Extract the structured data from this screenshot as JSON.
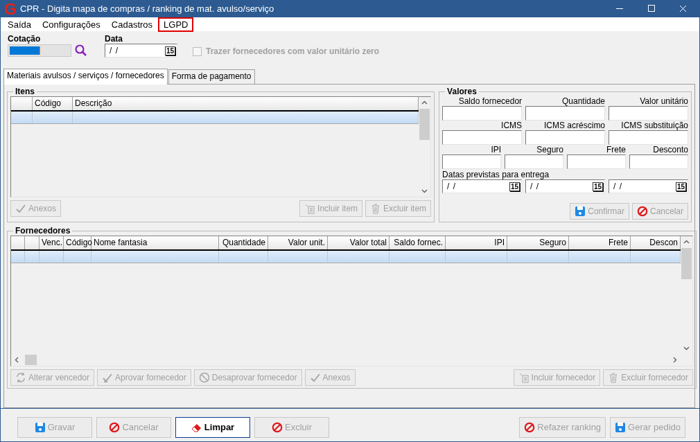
{
  "window": {
    "title": "CPR - Digita mapa de compras / ranking de mat. avulso/serviço"
  },
  "menu": [
    {
      "label": "Saída",
      "highlighted": false
    },
    {
      "label": "Configurações",
      "highlighted": false
    },
    {
      "label": "Cadastros",
      "highlighted": false
    },
    {
      "label": "LGPD",
      "highlighted": true
    }
  ],
  "header": {
    "cotacao_label": "Cotação",
    "data_label": "Data",
    "data_value": "/ /",
    "data_button": "15",
    "checkbox": {
      "label": "Trazer fornecedores com valor unitário zero",
      "checked": false,
      "disabled": true
    }
  },
  "tabs": [
    {
      "label": "Materiais avulsos / serviços / fornecedores",
      "selected": true
    },
    {
      "label": "Forma de pagamento",
      "selected": false
    }
  ],
  "itens": {
    "title": "Itens",
    "columns": [
      "Código",
      "Descrição"
    ],
    "rows": [
      {
        "selected": true
      }
    ],
    "left_buttons": [
      {
        "label": "Anexos",
        "kind": "check",
        "disabled": true
      }
    ],
    "right_buttons": [
      {
        "label": "Incluir item",
        "kind": "add-doc",
        "disabled": true
      },
      {
        "label": "Excluir item",
        "kind": "trash",
        "disabled": true
      }
    ]
  },
  "valores": {
    "title": "Valores",
    "rows": [
      [
        {
          "label": "Saldo fornecedor"
        },
        {
          "label": "Quantidade"
        },
        {
          "label": "Valor unitário"
        }
      ],
      [
        {
          "label": "ICMS"
        },
        {
          "label": "ICMS acréscimo"
        },
        {
          "label": "ICMS substituição"
        }
      ],
      [
        {
          "label": "IPI"
        },
        {
          "label": "Seguro"
        },
        {
          "label": "Frete"
        },
        {
          "label": "Desconto"
        }
      ]
    ],
    "dates_label": "Datas previstas para entrega",
    "dates": [
      {
        "value": "/ /",
        "button": "15"
      },
      {
        "value": "/ /",
        "button": "15"
      },
      {
        "value": "/ /",
        "button": "15"
      }
    ],
    "buttons": [
      {
        "label": "Confirmar",
        "kind": "save",
        "disabled": true
      },
      {
        "label": "Cancelar",
        "kind": "cancel",
        "disabled": true
      }
    ]
  },
  "fornecedores": {
    "title": "Fornecedores",
    "columns": [
      "Venc.",
      "Código",
      "Nome fantasia",
      "Quantidade",
      "Valor unit.",
      "Valor total",
      "Saldo fornec.",
      "IPI",
      "Seguro",
      "Frete",
      "Descon"
    ],
    "rows": [
      {
        "selected": true
      }
    ],
    "left_buttons": [
      {
        "label": "Alterar vencedor",
        "kind": "refresh",
        "disabled": true
      },
      {
        "label": "Aprovar fornecedor",
        "kind": "approve",
        "disabled": true
      },
      {
        "label": "Desaprovar fornecedor",
        "kind": "forbid",
        "disabled": true
      },
      {
        "label": "Anexos",
        "kind": "check",
        "disabled": true
      }
    ],
    "right_buttons": [
      {
        "label": "Incluir fornecedor",
        "kind": "add-doc",
        "disabled": true
      },
      {
        "label": "Excluir fornecedor",
        "kind": "trash",
        "disabled": true
      }
    ]
  },
  "footer": {
    "left_buttons": [
      {
        "label": "Gravar",
        "kind": "save",
        "disabled": true,
        "focused": false
      },
      {
        "label": "Cancelar",
        "kind": "cancel",
        "disabled": true,
        "focused": false
      },
      {
        "label": "Limpar",
        "kind": "eraser",
        "disabled": false,
        "focused": true
      },
      {
        "label": "Excluir",
        "kind": "cancel",
        "disabled": true,
        "focused": false
      }
    ],
    "right_buttons": [
      {
        "label": "Refazer ranking",
        "kind": "cancel",
        "disabled": true,
        "focused": false
      },
      {
        "label": "Gerar pedido",
        "kind": "save",
        "disabled": true,
        "focused": false
      }
    ]
  }
}
